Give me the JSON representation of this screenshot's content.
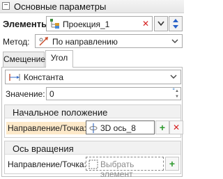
{
  "header": {
    "title": "Основные параметры",
    "collapse_icon": "minus-box-icon"
  },
  "elements": {
    "label": "Элементы:",
    "value": "Проекция_1",
    "icon": "tree-projection-icon"
  },
  "method": {
    "label": "Метод:",
    "value": "По направлению",
    "icon": "direction-icon"
  },
  "tabs": [
    {
      "label": "Смещение"
    },
    {
      "label": "Угол"
    }
  ],
  "active_tab": "Угол",
  "angle": {
    "mode": "Константа",
    "value_label": "Значение:",
    "value": "0",
    "unit": "°"
  },
  "start_position": {
    "title": "Начальное положение",
    "label": "Направление/Точка:",
    "value": "3D ось_8"
  },
  "rotation_axis": {
    "title": "Ось вращения",
    "label": "Направление/Точка:",
    "placeholder": "Выбрать элемент"
  },
  "colors": {
    "accent_add": "#2e9a2e",
    "accent_remove": "#d61f1f",
    "highlight": "#fde9c9"
  }
}
